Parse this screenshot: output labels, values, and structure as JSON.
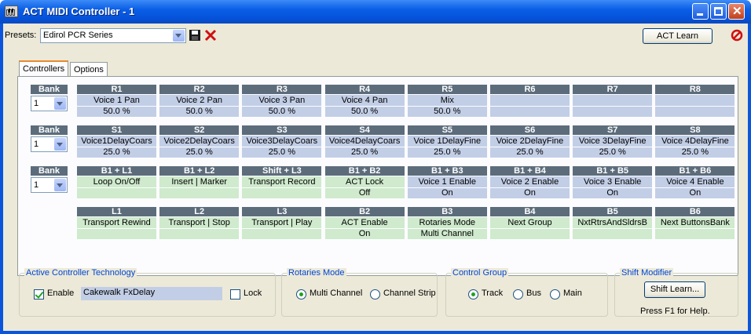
{
  "window": {
    "title": "ACT MIDI Controller - 1"
  },
  "toolbar": {
    "presets_label": "Presets:",
    "preset_value": "Edirol PCR Series",
    "act_learn_label": "ACT Learn"
  },
  "tabs": [
    {
      "label": "Controllers"
    },
    {
      "label": "Options"
    }
  ],
  "banks": [
    {
      "header": "Bank",
      "value": "1"
    },
    {
      "header": "Bank",
      "value": "1"
    },
    {
      "header": "Bank",
      "value": "1"
    }
  ],
  "rows": [
    {
      "style": "blue",
      "cells": [
        {
          "header": "R1",
          "name": "Voice 1 Pan",
          "value": "50.0 %"
        },
        {
          "header": "R2",
          "name": "Voice 2 Pan",
          "value": "50.0 %"
        },
        {
          "header": "R3",
          "name": "Voice 3 Pan",
          "value": "50.0 %"
        },
        {
          "header": "R4",
          "name": "Voice 4 Pan",
          "value": "50.0 %"
        },
        {
          "header": "R5",
          "name": "Mix",
          "value": "50.0 %"
        },
        {
          "header": "R6",
          "name": "",
          "value": ""
        },
        {
          "header": "R7",
          "name": "",
          "value": ""
        },
        {
          "header": "R8",
          "name": "",
          "value": ""
        }
      ]
    },
    {
      "style": "blue",
      "cells": [
        {
          "header": "S1",
          "name": "Voice1DelayCoars",
          "value": "25.0 %"
        },
        {
          "header": "S2",
          "name": "Voice2DelayCoars",
          "value": "25.0 %"
        },
        {
          "header": "S3",
          "name": "Voice3DelayCoars",
          "value": "25.0 %"
        },
        {
          "header": "S4",
          "name": "Voice4DelayCoars",
          "value": "25.0 %"
        },
        {
          "header": "S5",
          "name": "Voice 1DelayFine",
          "value": "25.0 %"
        },
        {
          "header": "S6",
          "name": "Voice 2DelayFine",
          "value": "25.0 %"
        },
        {
          "header": "S7",
          "name": "Voice 3DelayFine",
          "value": "25.0 %"
        },
        {
          "header": "S8",
          "name": "Voice 4DelayFine",
          "value": "25.0 %"
        }
      ]
    },
    {
      "style": "mixed",
      "cells": [
        {
          "header": "B1 + L1",
          "name": "Loop On/Off",
          "value": "",
          "color": "green"
        },
        {
          "header": "B1 + L2",
          "name": "Insert | Marker",
          "value": "",
          "color": "green"
        },
        {
          "header": "Shift + L3",
          "name": "Transport Record",
          "value": "",
          "color": "green"
        },
        {
          "header": "B1 + B2",
          "name": "ACT Lock",
          "value": "Off",
          "color": "green"
        },
        {
          "header": "B1 + B3",
          "name": "Voice 1 Enable",
          "value": "On",
          "color": "blue"
        },
        {
          "header": "B1 + B4",
          "name": "Voice 2 Enable",
          "value": "On",
          "color": "blue"
        },
        {
          "header": "B1 + B5",
          "name": "Voice 3 Enable",
          "value": "On",
          "color": "blue"
        },
        {
          "header": "B1 + B6",
          "name": "Voice 4 Enable",
          "value": "On",
          "color": "blue"
        }
      ]
    },
    {
      "style": "green",
      "cells": [
        {
          "header": "L1",
          "name": "Transport Rewind",
          "value": ""
        },
        {
          "header": "L2",
          "name": "Transport | Stop",
          "value": ""
        },
        {
          "header": "L3",
          "name": "Transport | Play",
          "value": ""
        },
        {
          "header": "B2",
          "name": "ACT Enable",
          "value": "On"
        },
        {
          "header": "B3",
          "name": "Rotaries Mode",
          "value": "Multi Channel"
        },
        {
          "header": "B4",
          "name": "Next Group",
          "value": ""
        },
        {
          "header": "B5",
          "name": "NxtRtrsAndSldrsB",
          "value": ""
        },
        {
          "header": "B6",
          "name": "Next ButtonsBank",
          "value": ""
        }
      ]
    }
  ],
  "act_group": {
    "title": "Active Controller Technology",
    "enable_label": "Enable",
    "enable_checked": true,
    "plugin_name": "Cakewalk FxDelay",
    "lock_label": "Lock",
    "lock_checked": false
  },
  "rotaries_group": {
    "title": "Rotaries Mode",
    "options": [
      {
        "label": "Multi Channel",
        "selected": true
      },
      {
        "label": "Channel Strip",
        "selected": false
      }
    ]
  },
  "control_group": {
    "title": "Control Group",
    "options": [
      {
        "label": "Track",
        "selected": true
      },
      {
        "label": "Bus",
        "selected": false
      },
      {
        "label": "Main",
        "selected": false
      }
    ]
  },
  "shift_group": {
    "title": "Shift Modifier",
    "button_label": "Shift Learn...",
    "help_text": "Press F1 for Help."
  },
  "colors": {
    "header_bg": "#5c6c7b",
    "cell_blue": "#c2cee6",
    "cell_green": "#cfeacd",
    "title_blue": "#0a5ee6"
  }
}
